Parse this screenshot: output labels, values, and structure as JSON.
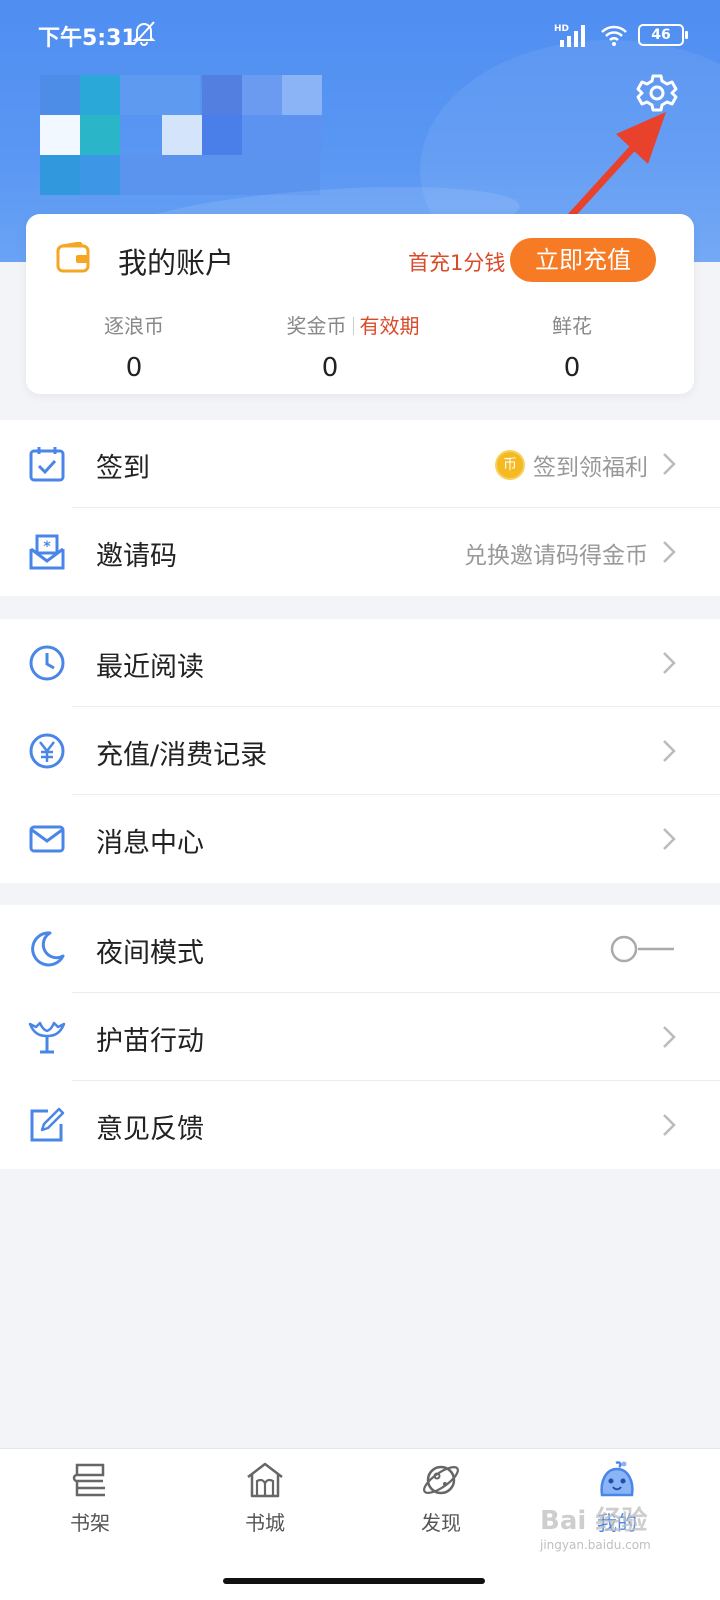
{
  "status_bar": {
    "time": "下午5:31",
    "network": "HD",
    "battery": "46"
  },
  "account": {
    "title": "我的账户",
    "first_charge_text": "首充1分钱",
    "recharge_label": "立即充值",
    "stats": [
      {
        "label": "逐浪币",
        "value": "0"
      },
      {
        "label": "奖金币",
        "validity": "有效期",
        "value": "0"
      },
      {
        "label": "鲜花",
        "value": "0"
      }
    ]
  },
  "menu_groups": [
    {
      "items": [
        {
          "label": "签到",
          "extra": "签到领福利",
          "coin": "币",
          "icon": "calendar-check-icon"
        },
        {
          "label": "邀请码",
          "extra": "兑换邀请码得金币",
          "icon": "invite-envelope-icon"
        }
      ]
    },
    {
      "items": [
        {
          "label": "最近阅读",
          "icon": "clock-icon"
        },
        {
          "label": "充值/消费记录",
          "icon": "yuan-icon"
        },
        {
          "label": "消息中心",
          "icon": "mail-icon"
        }
      ]
    },
    {
      "items": [
        {
          "label": "夜间模式",
          "icon": "moon-icon",
          "toggle": false
        },
        {
          "label": "护苗行动",
          "icon": "sprout-icon"
        },
        {
          "label": "意见反馈",
          "icon": "edit-icon"
        }
      ]
    }
  ],
  "bottom_nav": [
    {
      "label": "书架",
      "icon": "bookshelf-icon"
    },
    {
      "label": "书城",
      "icon": "bookstore-icon"
    },
    {
      "label": "发现",
      "icon": "planet-icon"
    },
    {
      "label": "我的",
      "icon": "profile-mascot-icon",
      "active": true
    }
  ],
  "watermark": {
    "text": "Bai 经验",
    "url": "jingyan.baidu.com"
  },
  "colors": {
    "header_blue": "#4f8ef2",
    "accent_orange": "#f67b24",
    "accent_red": "#d94a2a",
    "icon_blue": "#4a86e8",
    "arrow_red": "#e8412c"
  }
}
